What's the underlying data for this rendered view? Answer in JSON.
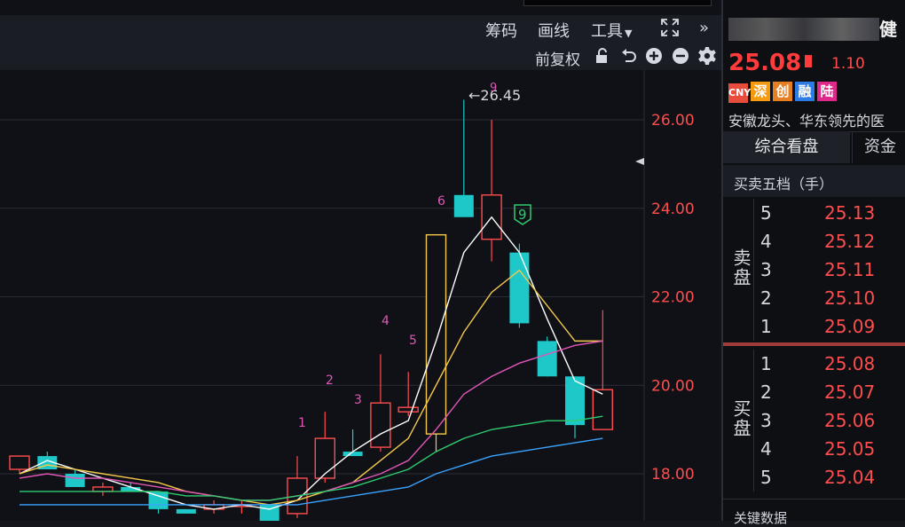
{
  "toolbar": {
    "chips": "筹码",
    "draw": "画线",
    "tools": "工具",
    "more": "»"
  },
  "subbar": {
    "adjust": "前复权"
  },
  "chart": {
    "high_label": "←26.45",
    "top_marker": "9",
    "nine_signal": "9",
    "yaxis": [
      "26.00",
      "24.00",
      "22.00",
      "20.00",
      "18.00"
    ],
    "count_labels": [
      "1",
      "2",
      "3",
      "4",
      "5",
      "6"
    ]
  },
  "chart_data": {
    "type": "candlestick",
    "ylim": [
      17.0,
      27.0
    ],
    "yticks": [
      26.0,
      24.0,
      22.0,
      20.0,
      18.0
    ],
    "candles": [
      {
        "o": 18.1,
        "h": 18.3,
        "l": 18.0,
        "c": 18.4
      },
      {
        "o": 18.4,
        "h": 18.5,
        "l": 18.1,
        "c": 18.1
      },
      {
        "o": 18.0,
        "h": 18.1,
        "l": 17.7,
        "c": 17.7
      },
      {
        "o": 17.6,
        "h": 17.8,
        "l": 17.5,
        "c": 17.7
      },
      {
        "o": 17.7,
        "h": 17.8,
        "l": 17.6,
        "c": 17.6
      },
      {
        "o": 17.6,
        "h": 17.6,
        "l": 17.1,
        "c": 17.2
      },
      {
        "o": 17.2,
        "h": 17.2,
        "l": 17.1,
        "c": 17.1
      },
      {
        "o": 17.2,
        "h": 17.4,
        "l": 17.1,
        "c": 17.3
      },
      {
        "o": 17.3,
        "h": 17.4,
        "l": 17.1,
        "c": 17.3
      },
      {
        "o": 17.3,
        "h": 17.3,
        "l": 16.9,
        "c": 16.9
      },
      {
        "o": 17.1,
        "h": 18.4,
        "l": 17.0,
        "c": 17.9
      },
      {
        "o": 17.9,
        "h": 19.4,
        "l": 17.8,
        "c": 18.8
      },
      {
        "o": 18.5,
        "h": 19.0,
        "l": 18.4,
        "c": 18.4
      },
      {
        "o": 18.6,
        "h": 20.7,
        "l": 18.5,
        "c": 19.6
      },
      {
        "o": 19.4,
        "h": 20.3,
        "l": 19.3,
        "c": 19.5
      },
      {
        "o": 18.9,
        "h": 18.9,
        "l": 18.5,
        "c": 23.4
      },
      {
        "o": 24.3,
        "h": 26.45,
        "l": 23.8,
        "c": 23.8
      },
      {
        "o": 23.3,
        "h": 26.0,
        "l": 22.8,
        "c": 24.3
      },
      {
        "o": 23.0,
        "h": 23.2,
        "l": 21.3,
        "c": 21.4
      },
      {
        "o": 21.0,
        "h": 21.1,
        "l": 20.2,
        "c": 20.2
      },
      {
        "o": 20.2,
        "h": 20.2,
        "l": 18.8,
        "c": 19.1
      },
      {
        "o": 19.0,
        "h": 21.7,
        "l": 19.0,
        "c": 19.9
      }
    ],
    "ma_series": [
      {
        "color": "#ffffff",
        "values": [
          18.0,
          18.3,
          18.1,
          17.9,
          17.7,
          17.5,
          17.3,
          17.2,
          17.3,
          17.2,
          17.4,
          18.0,
          18.5,
          18.9,
          19.2,
          21.0,
          23.0,
          23.8,
          23.0,
          21.5,
          20.1,
          19.8
        ]
      },
      {
        "color": "#f2c94c",
        "values": [
          18.0,
          18.2,
          18.1,
          18.0,
          17.9,
          17.8,
          17.6,
          17.5,
          17.4,
          17.3,
          17.4,
          17.6,
          17.8,
          18.3,
          18.8,
          20.0,
          21.2,
          22.1,
          22.6,
          21.8,
          21.0,
          21.0
        ]
      },
      {
        "color": "#e056b8",
        "values": [
          17.9,
          18.0,
          17.9,
          17.9,
          17.8,
          17.7,
          17.6,
          17.5,
          17.4,
          17.4,
          17.5,
          17.6,
          17.8,
          18.0,
          18.3,
          19.0,
          19.8,
          20.2,
          20.5,
          20.7,
          20.9,
          21.0
        ]
      },
      {
        "color": "#2ecc71",
        "values": [
          17.6,
          17.6,
          17.6,
          17.6,
          17.6,
          17.6,
          17.5,
          17.5,
          17.4,
          17.4,
          17.5,
          17.6,
          17.7,
          17.9,
          18.1,
          18.5,
          18.8,
          19.0,
          19.1,
          19.2,
          19.2,
          19.3
        ]
      },
      {
        "color": "#3aa3ff",
        "values": [
          17.3,
          17.3,
          17.3,
          17.3,
          17.3,
          17.3,
          17.3,
          17.3,
          17.3,
          17.3,
          17.3,
          17.4,
          17.5,
          17.6,
          17.7,
          18.0,
          18.2,
          18.4,
          18.5,
          18.6,
          18.7,
          18.8
        ]
      }
    ]
  },
  "stock": {
    "price": "25.08",
    "change": "1.10"
  },
  "badges": [
    {
      "text": "CNY",
      "color": "#e74c3c"
    },
    {
      "text": "深",
      "color": "#f39c12"
    },
    {
      "text": "创",
      "color": "#e67e22"
    },
    {
      "text": "融",
      "color": "#2d7be5"
    },
    {
      "text": "陆",
      "color": "#e0288a"
    }
  ],
  "description": "安徽龙头、华东领先的医",
  "tabs": {
    "overview": "综合看盘",
    "funds": "资金"
  },
  "orderbook": {
    "title": "买卖五档（手）",
    "sell_label": "卖盘",
    "buy_label": "买盘",
    "sell": [
      {
        "level": "5",
        "price": "25.13"
      },
      {
        "level": "4",
        "price": "25.12"
      },
      {
        "level": "3",
        "price": "25.11"
      },
      {
        "level": "2",
        "price": "25.10"
      },
      {
        "level": "1",
        "price": "25.09"
      }
    ],
    "buy": [
      {
        "level": "1",
        "price": "25.08"
      },
      {
        "level": "2",
        "price": "25.07"
      },
      {
        "level": "3",
        "price": "25.06"
      },
      {
        "level": "4",
        "price": "25.05"
      },
      {
        "level": "5",
        "price": "25.04"
      }
    ]
  },
  "footer": "关键数据"
}
